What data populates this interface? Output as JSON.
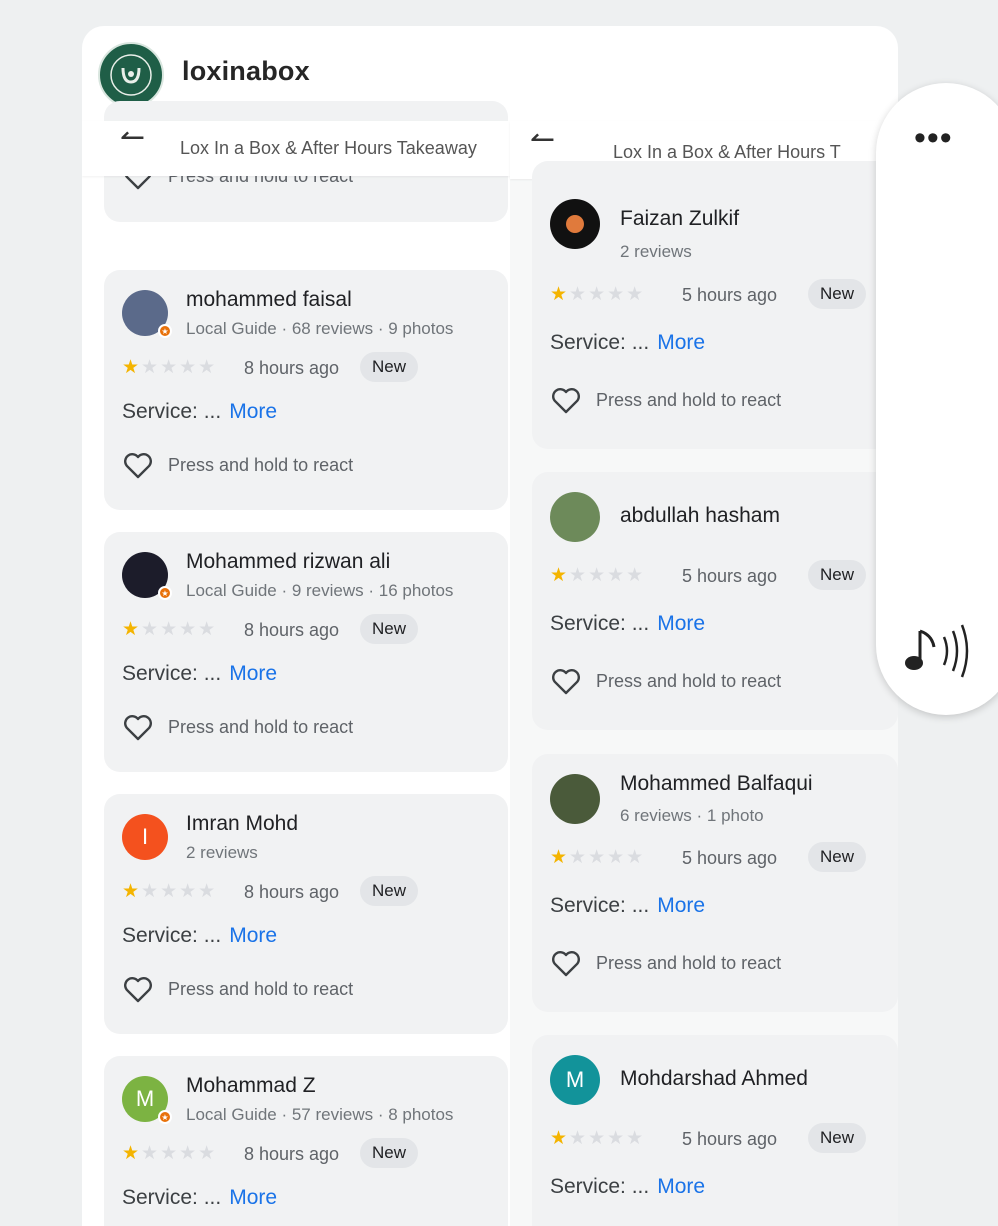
{
  "account": {
    "username": "loxinabox"
  },
  "left_column": {
    "title": "Lox In a Box & After Hours Takeaway",
    "partial_react": "Press and hold to react",
    "reviews": [
      {
        "name": "mohammed faisal",
        "meta": "Local Guide · 68 reviews · 9 photos",
        "time": "8 hours ago",
        "badge": "New",
        "service": "Service: ...",
        "more": "More",
        "react": "Press and hold to react",
        "rating": 1,
        "avatar_color": "#5b6a8a"
      },
      {
        "name": "Mohammed rizwan ali",
        "meta": "Local Guide · 9 reviews · 16 photos",
        "time": "8 hours ago",
        "badge": "New",
        "service": "Service: ...",
        "more": "More",
        "react": "Press and hold to react",
        "rating": 1,
        "avatar_color": "#1c1c2a"
      },
      {
        "name": "Imran Mohd",
        "meta": "2 reviews",
        "time": "8 hours ago",
        "badge": "New",
        "service": "Service: ...",
        "more": "More",
        "react": "Press and hold to react",
        "rating": 1,
        "avatar_letter": "I",
        "avatar_color": "#f4511e"
      },
      {
        "name": "Mohammad Z",
        "meta": "Local Guide · 57 reviews · 8 photos",
        "time": "8 hours ago",
        "badge": "New",
        "service": "Service: ...",
        "more": "More",
        "rating": 1,
        "avatar_letter": "M",
        "avatar_color": "#7cb342"
      }
    ]
  },
  "right_column": {
    "title": "Lox In a Box & After Hours T",
    "reviews": [
      {
        "name": "Faizan Zulkif",
        "meta": "2 reviews",
        "time": "5 hours ago",
        "badge": "New",
        "service": "Service: ...",
        "more": "More",
        "react": "Press and hold to react",
        "rating": 1,
        "avatar_color": "#111111"
      },
      {
        "name": "abdullah hasham",
        "time": "5 hours ago",
        "badge": "New",
        "service": "Service: ...",
        "more": "More",
        "react": "Press and hold to react",
        "rating": 1,
        "avatar_color": "#6d8a5a"
      },
      {
        "name": "Mohammed Balfaqui",
        "meta": "6 reviews · 1 photo",
        "time": "5 hours ago",
        "badge": "New",
        "service": "Service: ...",
        "more": "More",
        "react": "Press and hold to react",
        "rating": 1,
        "avatar_color": "#4a5a3a"
      },
      {
        "name": "Mohdarshad Ahmed",
        "time": "5 hours ago",
        "badge": "New",
        "service": "Service: ...",
        "more": "More",
        "rating": 1,
        "avatar_letter": "M",
        "avatar_color": "#12939a"
      }
    ]
  },
  "icons": {
    "menu": "more-horizontal-icon",
    "audio": "music-note-icon",
    "back": "back-arrow-icon",
    "react": "heart-icon",
    "star": "star-icon"
  },
  "colors": {
    "star": "#f4b400",
    "link": "#1a73e8",
    "guide_badge": "#e8710a"
  }
}
